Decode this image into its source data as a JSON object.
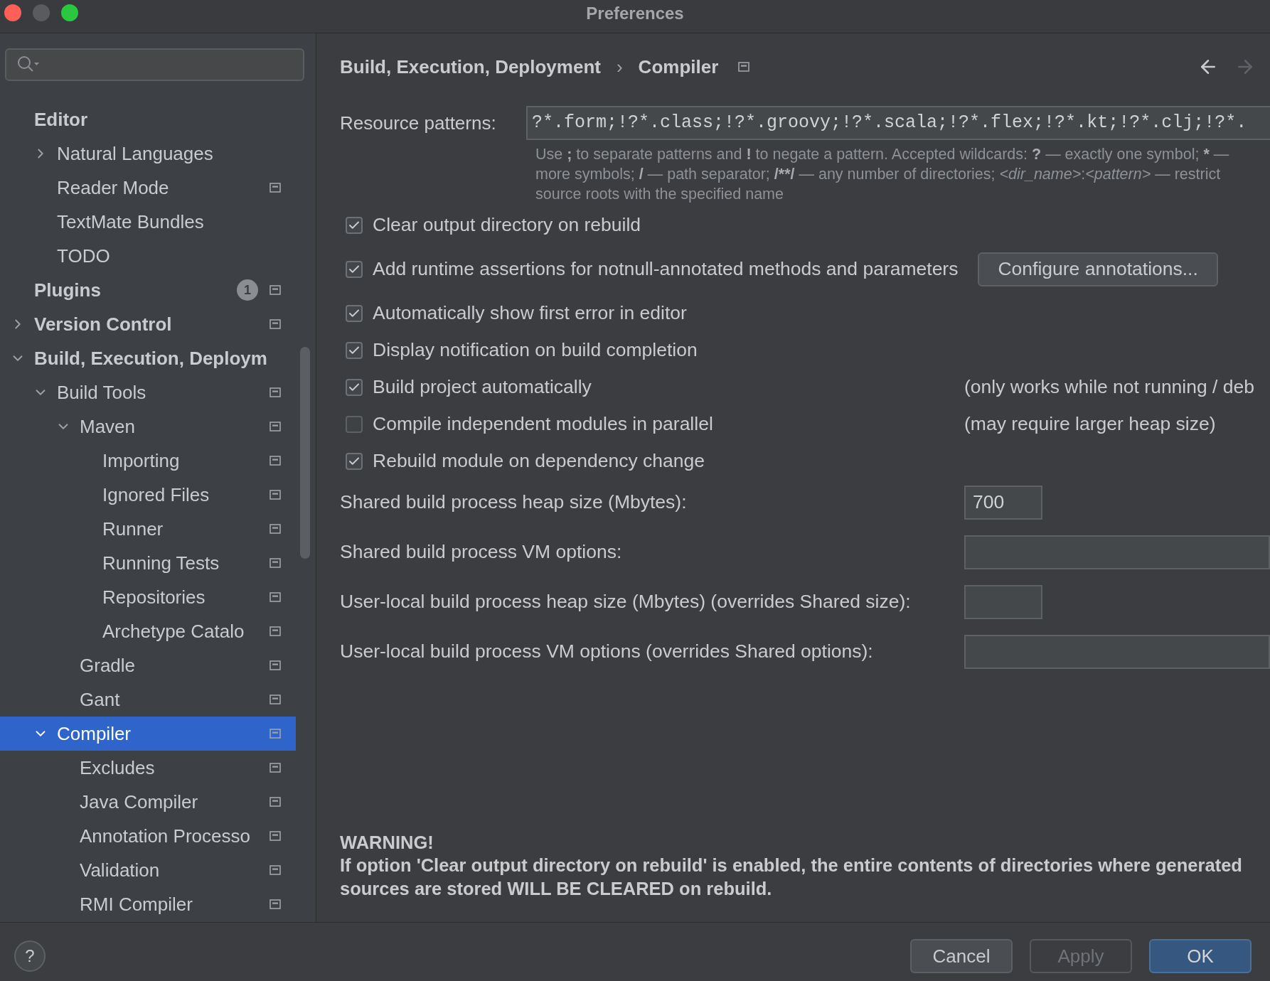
{
  "window": {
    "title": "Preferences"
  },
  "sidebar": {
    "tree": [
      {
        "label": "Editor",
        "selected": false,
        "project_icon": false,
        "children": [
          {
            "label": "Natural Languages",
            "expanded": false,
            "selected": false,
            "project_icon": false
          },
          {
            "label": "Reader Mode",
            "selected": false,
            "project_icon": true
          },
          {
            "label": "TextMate Bundles",
            "selected": false,
            "project_icon": false
          },
          {
            "label": "TODO",
            "selected": false,
            "project_icon": false
          }
        ]
      },
      {
        "label": "Plugins",
        "selected": false,
        "project_icon": true,
        "badge": "1"
      },
      {
        "label": "Version Control",
        "expanded": false,
        "selected": false,
        "project_icon": true
      },
      {
        "label": "Build, Execution, Deploym",
        "expanded": true,
        "selected": false,
        "project_icon": false,
        "children": [
          {
            "label": "Build Tools",
            "expanded": true,
            "selected": false,
            "project_icon": true,
            "children": [
              {
                "label": "Maven",
                "expanded": true,
                "selected": false,
                "project_icon": true,
                "children": [
                  {
                    "label": "Importing",
                    "selected": false,
                    "project_icon": true
                  },
                  {
                    "label": "Ignored Files",
                    "selected": false,
                    "project_icon": true
                  },
                  {
                    "label": "Runner",
                    "selected": false,
                    "project_icon": true
                  },
                  {
                    "label": "Running Tests",
                    "selected": false,
                    "project_icon": true
                  },
                  {
                    "label": "Repositories",
                    "selected": false,
                    "project_icon": true
                  },
                  {
                    "label": "Archetype Catalo",
                    "selected": false,
                    "project_icon": true
                  }
                ]
              },
              {
                "label": "Gradle",
                "selected": false,
                "project_icon": true
              },
              {
                "label": "Gant",
                "selected": false,
                "project_icon": true
              }
            ]
          },
          {
            "label": "Compiler",
            "expanded": true,
            "selected": true,
            "project_icon": true,
            "children": [
              {
                "label": "Excludes",
                "selected": false,
                "project_icon": true
              },
              {
                "label": "Java Compiler",
                "selected": false,
                "project_icon": true
              },
              {
                "label": "Annotation Processo",
                "selected": false,
                "project_icon": true
              },
              {
                "label": "Validation",
                "selected": false,
                "project_icon": true
              },
              {
                "label": "RMI Compiler",
                "selected": false,
                "project_icon": true
              }
            ]
          }
        ]
      }
    ]
  },
  "breadcrumb": {
    "items": [
      "Build, Execution, Deployment",
      "Compiler"
    ],
    "separator": "›",
    "back_enabled": true,
    "forward_enabled": false
  },
  "resource_patterns": {
    "label": "Resource patterns:",
    "value": "?*.form;!?*.class;!?*.groovy;!?*.scala;!?*.flex;!?*.kt;!?*.clj;!?*.",
    "hint": [
      {
        "text": "Use ",
        "kind": "plain"
      },
      {
        "text": ";",
        "kind": "bold"
      },
      {
        "text": " to separate patterns and ",
        "kind": "plain"
      },
      {
        "text": "!",
        "kind": "bold"
      },
      {
        "text": " to negate a pattern. Accepted wildcards: ",
        "kind": "plain"
      },
      {
        "text": "?",
        "kind": "bold"
      },
      {
        "text": " — exactly one symbol; ",
        "kind": "plain"
      },
      {
        "text": "*",
        "kind": "bold"
      },
      {
        "text": " —\nmore symbols; ",
        "kind": "plain"
      },
      {
        "text": "/",
        "kind": "bold"
      },
      {
        "text": " — path separator; ",
        "kind": "plain"
      },
      {
        "text": "/**/",
        "kind": "bold"
      },
      {
        "text": " — any number of directories; ",
        "kind": "plain"
      },
      {
        "text": "<dir_name>",
        "kind": "italic"
      },
      {
        "text": ":",
        "kind": "plain"
      },
      {
        "text": "<pattern>",
        "kind": "italic"
      },
      {
        "text": " — restrict\nsource roots with the specified name",
        "kind": "plain"
      }
    ]
  },
  "options": [
    {
      "label": "Clear output directory on rebuild",
      "checked": true
    },
    {
      "label": "Add runtime assertions for notnull-annotated methods and parameters",
      "checked": true,
      "button": "Configure annotations..."
    },
    {
      "label": "Automatically show first error in editor",
      "checked": true
    },
    {
      "label": "Display notification on build completion",
      "checked": true
    },
    {
      "label": "Build project automatically",
      "checked": true,
      "note": "(only works while not running / deb"
    },
    {
      "label": "Compile independent modules in parallel",
      "checked": false,
      "note": "(may require larger heap size)"
    },
    {
      "label": "Rebuild module on dependency change",
      "checked": true
    }
  ],
  "fields": [
    {
      "label": "Shared build process heap size (Mbytes):",
      "value": "700",
      "kind": "short"
    },
    {
      "label": "Shared build process VM options:",
      "kind": "wide"
    },
    {
      "label": "User-local build process heap size (Mbytes) (overrides Shared size):",
      "kind": "short"
    },
    {
      "label": "User-local build process VM options (overrides Shared options):",
      "kind": "wide"
    }
  ],
  "warning": {
    "title": "WARNING!",
    "text": "If option 'Clear output directory on rebuild' is enabled, the entire contents of directories where generated sources are stored WILL BE CLEARED on rebuild."
  },
  "footer": {
    "help": "?",
    "buttons": [
      {
        "label": "Cancel",
        "kind": "normal",
        "disabled": false
      },
      {
        "label": "Apply",
        "kind": "normal",
        "disabled": true
      },
      {
        "label": "OK",
        "kind": "default",
        "disabled": false
      }
    ]
  }
}
